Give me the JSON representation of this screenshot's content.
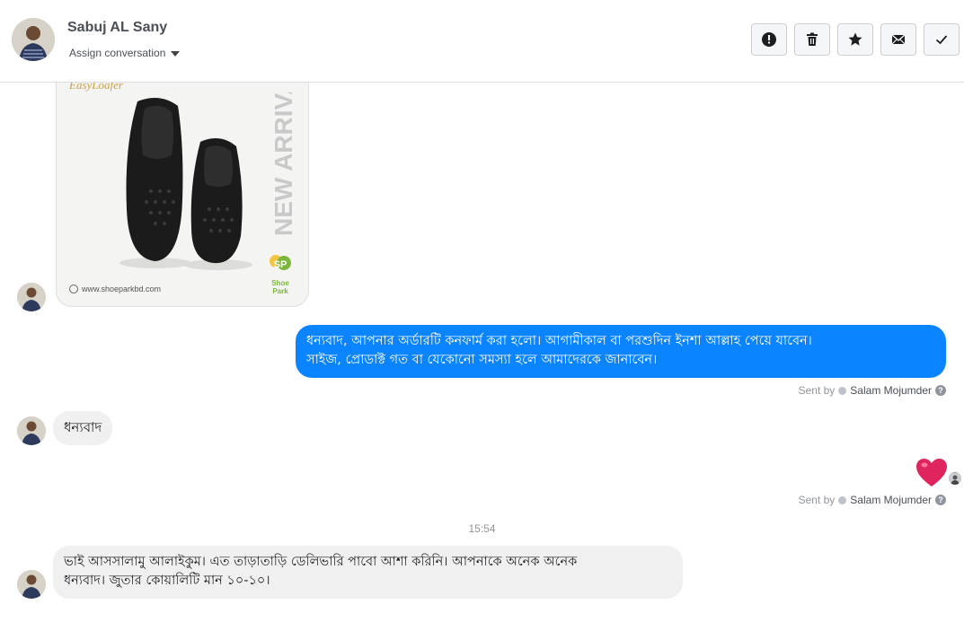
{
  "header": {
    "contact_name": "Sabuj AL Sany",
    "assign_label": "Assign conversation",
    "actions": [
      {
        "name": "mark-spam-button",
        "icon": "exclamation-circle-icon"
      },
      {
        "name": "delete-button",
        "icon": "trash-icon"
      },
      {
        "name": "star-button",
        "icon": "star-icon"
      },
      {
        "name": "mark-unread-button",
        "icon": "envelope-icon"
      },
      {
        "name": "mark-done-button",
        "icon": "check-icon"
      }
    ]
  },
  "product_card": {
    "brand": "EasyLoafer",
    "badge": "NEW ARRIVAL",
    "url": "www.shoeparkbd.com",
    "logo_text": "Shoe Park"
  },
  "messages": {
    "out_1": {
      "line1": "ধন্যবাদ, আপনার অর্ডারটি কনফার্ম করা হলো। আগামীকাল বা পরশুদিন ইনশা আল্লাহ পেয়ে যাবেন।",
      "line2": "সাইজ, প্রোডাক্ট গত বা যেকোনো সমস্যা হলে আমাদেরকে জানাবেন।"
    },
    "sent_by_1": {
      "prefix": "Sent by",
      "name": "Salam Mojumder"
    },
    "in_1": "ধন্যবাদ",
    "reaction": "heart",
    "sent_by_2": {
      "prefix": "Sent by",
      "name": "Salam Mojumder"
    },
    "timestamp": "15:54",
    "in_2": {
      "line1": "ভাই আসসালামু আলাইকুম। এত তাড়াতাড়ি ডেলিভারি পাবো আশা করিনি। আপনাকে অনেক অনেক",
      "line2": "ধন্যবাদ। জুতার কোয়ালিটি মান ১০-১০।"
    }
  },
  "colors": {
    "outgoing_bubble": "#0a84ff",
    "incoming_bubble": "#f1f0f0",
    "heart": "#e0245e"
  }
}
